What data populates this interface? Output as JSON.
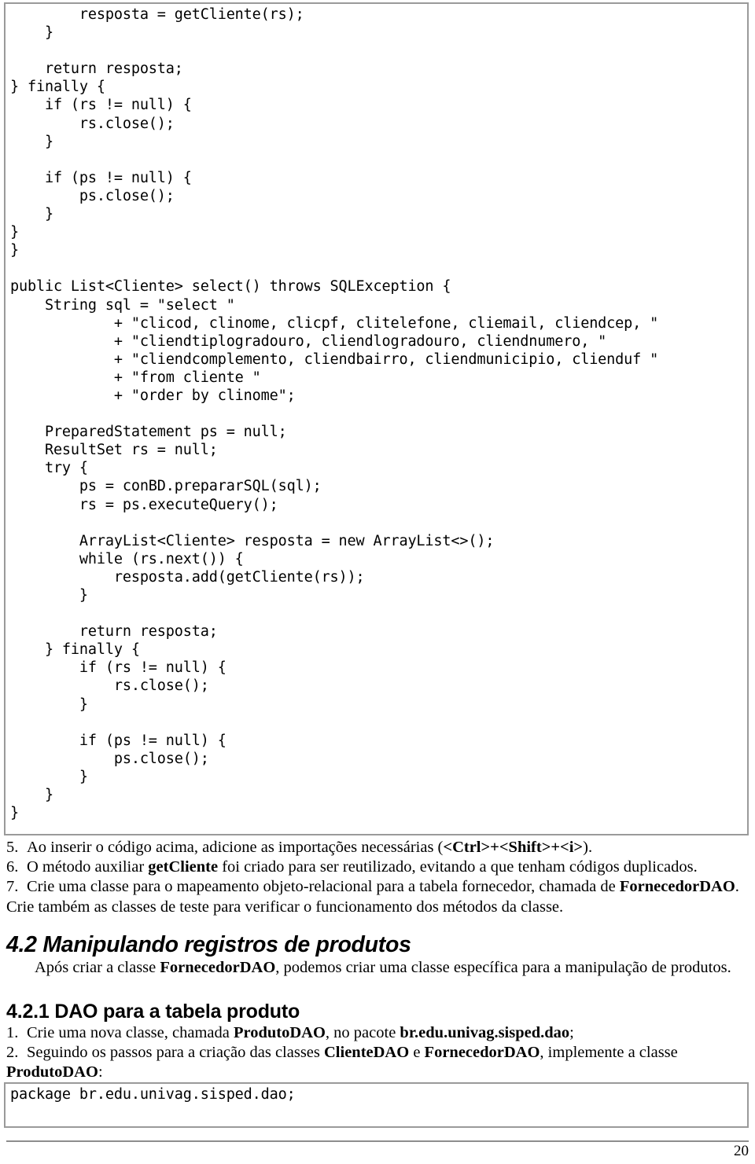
{
  "document": {
    "page_number": "20"
  },
  "code_top": {
    "language": "java",
    "text": "        resposta = getCliente(rs);\n    }\n\n    return resposta;\n} finally {\n    if (rs != null) {\n        rs.close();\n    }\n\n    if (ps != null) {\n        ps.close();\n    }\n}\n}\n\npublic List<Cliente> select() throws SQLException {\n    String sql = \"select \"\n            + \"clicod, clinome, clicpf, clitelefone, cliemail, cliendcep, \"\n            + \"cliendtiplogradouro, cliendlogradouro, cliendnumero, \"\n            + \"cliendcomplemento, cliendbairro, cliendmunicipio, clienduf \"\n            + \"from cliente \"\n            + \"order by clinome\";\n\n    PreparedStatement ps = null;\n    ResultSet rs = null;\n    try {\n        ps = conBD.prepararSQL(sql);\n        rs = ps.executeQuery();\n\n        ArrayList<Cliente> resposta = new ArrayList<>();\n        while (rs.next()) {\n            resposta.add(getCliente(rs));\n        }\n\n        return resposta;\n    } finally {\n        if (rs != null) {\n            rs.close();\n        }\n\n        if (ps != null) {\n            ps.close();\n        }\n    }\n}"
  },
  "instructions": [
    {
      "marker": "5.",
      "parts": [
        {
          "text": "Ao inserir o código acima, adicione as importações necessárias (",
          "bold": false
        },
        {
          "text": "<Ctrl>+<Shift>+<i>",
          "bold": true
        },
        {
          "text": ").",
          "bold": false
        }
      ]
    },
    {
      "marker": "6.",
      "parts": [
        {
          "text": "O método auxiliar ",
          "bold": false
        },
        {
          "text": "getCliente",
          "bold": true
        },
        {
          "text": " foi criado para ser reutilizado, evitando a que tenham códigos duplicados.",
          "bold": false
        }
      ]
    },
    {
      "marker": "7.",
      "parts": [
        {
          "text": "Crie uma classe para o mapeamento objeto-relacional para a tabela fornecedor, chamada de ",
          "bold": false
        },
        {
          "text": "FornecedorDAO",
          "bold": true
        },
        {
          "text": ".",
          "bold": false
        }
      ]
    }
  ],
  "continuation_line": {
    "parts": [
      {
        "text": "Crie também as classes de teste para verificar o funcionamento dos métodos da classe.",
        "bold": false
      }
    ]
  },
  "section_4_2": {
    "heading": "4.2 Manipulando registros de produtos",
    "paragraph_parts": [
      {
        "text": "Após criar a classe ",
        "bold": false
      },
      {
        "text": "FornecedorDAO",
        "bold": true
      },
      {
        "text": ", podemos criar uma classe específica para a manipulação de produtos.",
        "bold": false
      }
    ]
  },
  "section_4_2_1": {
    "heading": "4.2.1 DAO para a tabela produto",
    "items": [
      {
        "marker": "1.",
        "parts": [
          {
            "text": "Crie uma nova classe, chamada ",
            "bold": false
          },
          {
            "text": "ProdutoDAO",
            "bold": true
          },
          {
            "text": ", no pacote ",
            "bold": false
          },
          {
            "text": "br.edu.univag.sisped.dao",
            "bold": true
          },
          {
            "text": ";",
            "bold": false
          }
        ]
      },
      {
        "marker": "2.",
        "parts": [
          {
            "text": "Seguindo os passos para a criação das classes ",
            "bold": false
          },
          {
            "text": "ClienteDAO",
            "bold": true
          },
          {
            "text": " e ",
            "bold": false
          },
          {
            "text": "FornecedorDAO",
            "bold": true
          },
          {
            "text": ", implemente a classe",
            "bold": false
          }
        ]
      }
    ],
    "item2_continuation": [
      {
        "text": "ProdutoDAO",
        "bold": true
      },
      {
        "text": ":",
        "bold": false
      }
    ]
  },
  "code_bottom": {
    "language": "java",
    "text": "package br.edu.univag.sisped.dao;"
  },
  "colors": {
    "text": "#000000",
    "code_border": "#9a9a9a",
    "footer_rule": "#8d8d8d",
    "background": "#ffffff"
  }
}
